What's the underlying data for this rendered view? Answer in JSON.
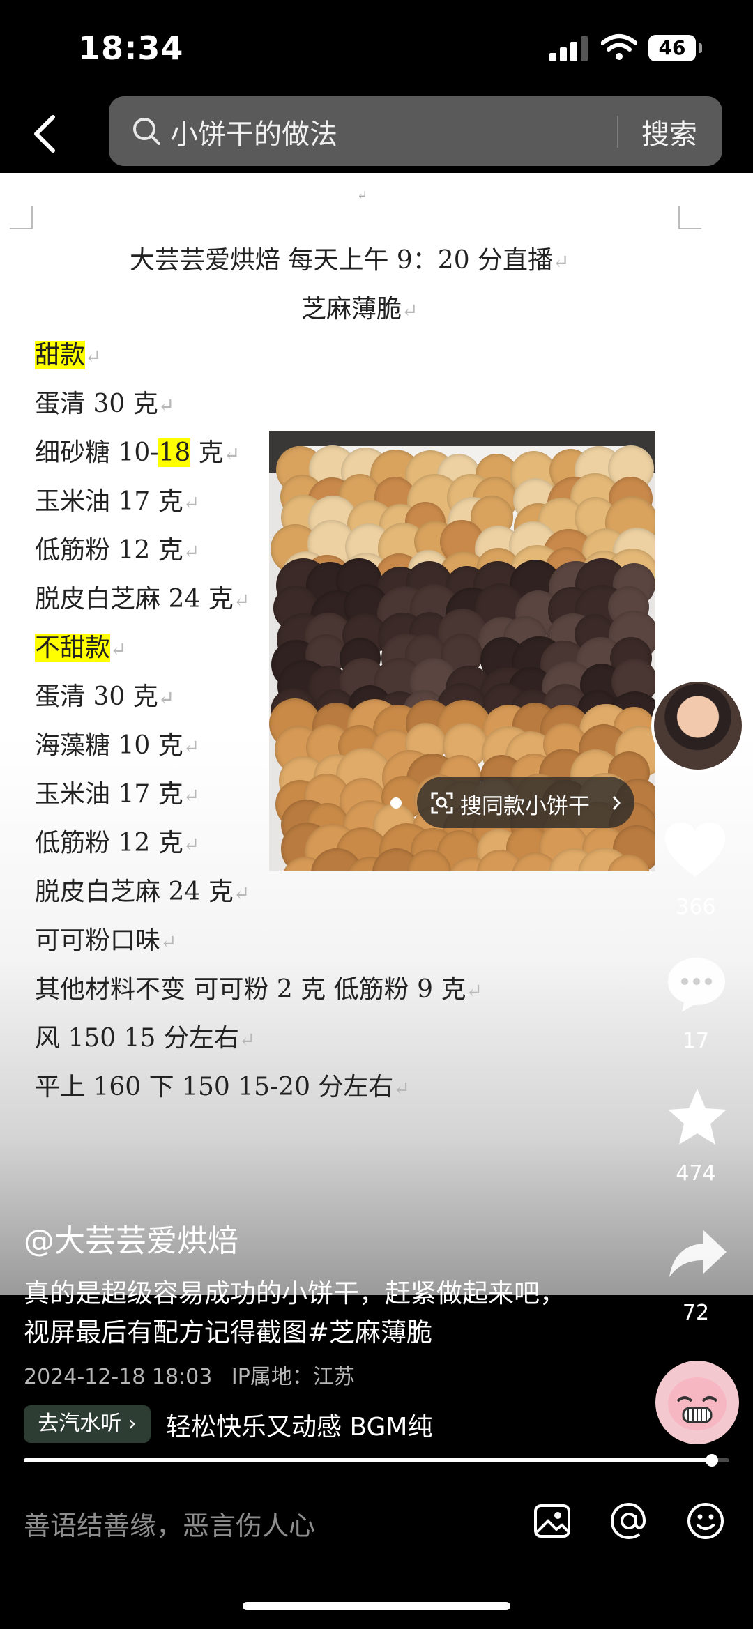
{
  "status": {
    "time": "18:34",
    "battery": "46"
  },
  "search": {
    "query": "小饼干的做法",
    "button": "搜索"
  },
  "doc": {
    "title": "大芸芸爱烘焙 每天上午 9：20 分直播",
    "subtitle": "芝麻薄脆",
    "lines": [
      {
        "pre": "",
        "hl": "甜款",
        "post": ""
      },
      {
        "pre": "蛋清 30 克",
        "hl": "",
        "post": ""
      },
      {
        "pre": "细砂糖 10-",
        "hl": "18",
        "post": " 克"
      },
      {
        "pre": "玉米油 17 克",
        "hl": "",
        "post": ""
      },
      {
        "pre": "低筋粉 12 克",
        "hl": "",
        "post": ""
      },
      {
        "pre": "脱皮白芝麻 24 克",
        "hl": "",
        "post": ""
      },
      {
        "pre": "",
        "hl": "不甜款",
        "post": ""
      },
      {
        "pre": "蛋清 30 克",
        "hl": "",
        "post": ""
      },
      {
        "pre": "海藻糖 10 克",
        "hl": "",
        "post": ""
      },
      {
        "pre": "玉米油 17 克",
        "hl": "",
        "post": ""
      },
      {
        "pre": "低筋粉 12 克",
        "hl": "",
        "post": ""
      },
      {
        "pre": "脱皮白芝麻 24 克",
        "hl": "",
        "post": ""
      },
      {
        "pre": "可可粉口味",
        "hl": "",
        "post": ""
      },
      {
        "pre": "其他材料不变 可可粉 2 克 低筋粉 9 克",
        "hl": "",
        "post": ""
      },
      {
        "pre": "风 150 15 分左右",
        "hl": "",
        "post": ""
      },
      {
        "pre": "平上 160 下 150 15-20 分左右",
        "hl": "",
        "post": ""
      }
    ],
    "find_same": "搜同款小饼干"
  },
  "rail": {
    "likes": "366",
    "comments": "17",
    "favorites": "474",
    "shares": "72"
  },
  "post": {
    "author": "@大芸芸爱烘焙",
    "description": "真的是超级容易成功的小饼干，赶紧做起来吧，视屏最后有配方记得截图#芝麻薄脆",
    "datetime": "2024-12-18 18:03",
    "ip": "IP属地：江苏",
    "music_tag": "去汽水听",
    "music": "轻松快乐又动感 BGM纯"
  },
  "progress": 0.975,
  "comment_placeholder": "善语结善缘，恶言伤人心",
  "colors": {
    "highlight": "#ffff00",
    "search_bg": "#5a5a5a",
    "music_tag_bg": "#2d3d34"
  },
  "icons": [
    "back-arrow-icon",
    "search-icon",
    "image-icon",
    "at-icon",
    "emoji-icon",
    "heart-icon",
    "comment-icon",
    "star-icon",
    "share-icon",
    "scan-icon",
    "chevron-right-icon"
  ]
}
